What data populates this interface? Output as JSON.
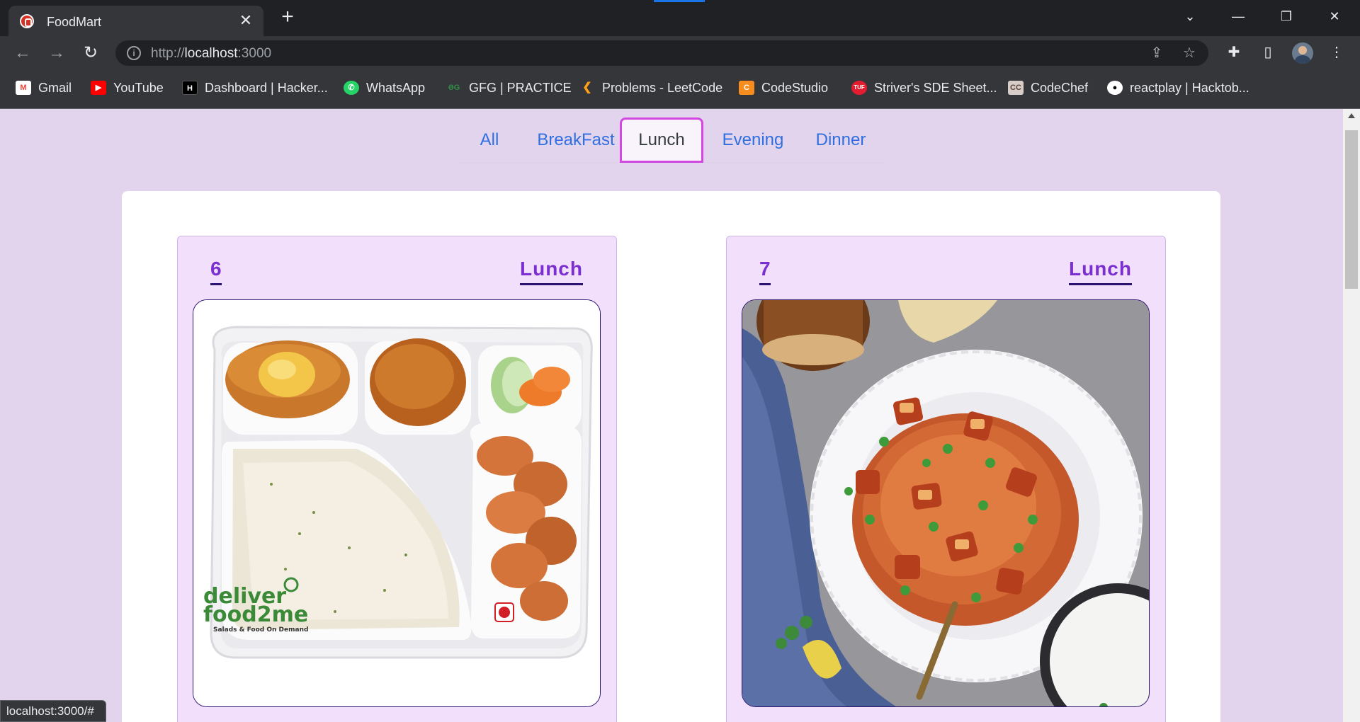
{
  "browser": {
    "tab": {
      "title": "FoodMart",
      "close_glyph": "✕"
    },
    "new_tab_glyph": "+",
    "window_controls": {
      "dropdown": "⌄",
      "minimize": "—",
      "restore": "❐",
      "close": "✕"
    },
    "nav": {
      "back": "←",
      "forward": "→",
      "reload": "↻"
    },
    "address": {
      "scheme": "http://",
      "host": "localhost",
      "port": ":3000"
    },
    "bookmarks": [
      {
        "label": "Gmail",
        "icon": "gmail-icon",
        "color": "#ea4335"
      },
      {
        "label": "YouTube",
        "icon": "youtube-icon",
        "color": "#ff0000"
      },
      {
        "label": "Dashboard | Hacker...",
        "icon": "hackerrank-icon",
        "color": "#000000"
      },
      {
        "label": "WhatsApp",
        "icon": "whatsapp-icon",
        "color": "#25d366"
      },
      {
        "label": "GFG | PRACTICE",
        "icon": "gfg-icon",
        "color": "#2f8d46"
      },
      {
        "label": "Problems - LeetCode",
        "icon": "leetcode-icon",
        "color": "#ffa116"
      },
      {
        "label": "CodeStudio",
        "icon": "codestudio-icon",
        "color": "#f78c1f"
      },
      {
        "label": "Striver's SDE Sheet...",
        "icon": "tuf-icon",
        "color": "#e11d2f"
      },
      {
        "label": "CodeChef",
        "icon": "codechef-icon",
        "color": "#5b4638"
      },
      {
        "label": "reactplay | Hacktob...",
        "icon": "github-icon",
        "color": "#ffffff"
      }
    ],
    "status_url": "localhost:3000/#"
  },
  "page": {
    "filters": [
      {
        "label": "All",
        "active": false
      },
      {
        "label": "BreakFast",
        "active": false
      },
      {
        "label": "Lunch",
        "active": true
      },
      {
        "label": "Evening",
        "active": false
      },
      {
        "label": "Dinner",
        "active": false
      }
    ],
    "cards": [
      {
        "number": "6",
        "category": "Lunch",
        "image": "lunch-thali-image",
        "brand_line1": "deliver",
        "brand_line2": "food2me",
        "brand_tagline": "Salads & Food On Demand"
      },
      {
        "number": "7",
        "category": "Lunch",
        "image": "paneer-pulao-image"
      }
    ]
  }
}
